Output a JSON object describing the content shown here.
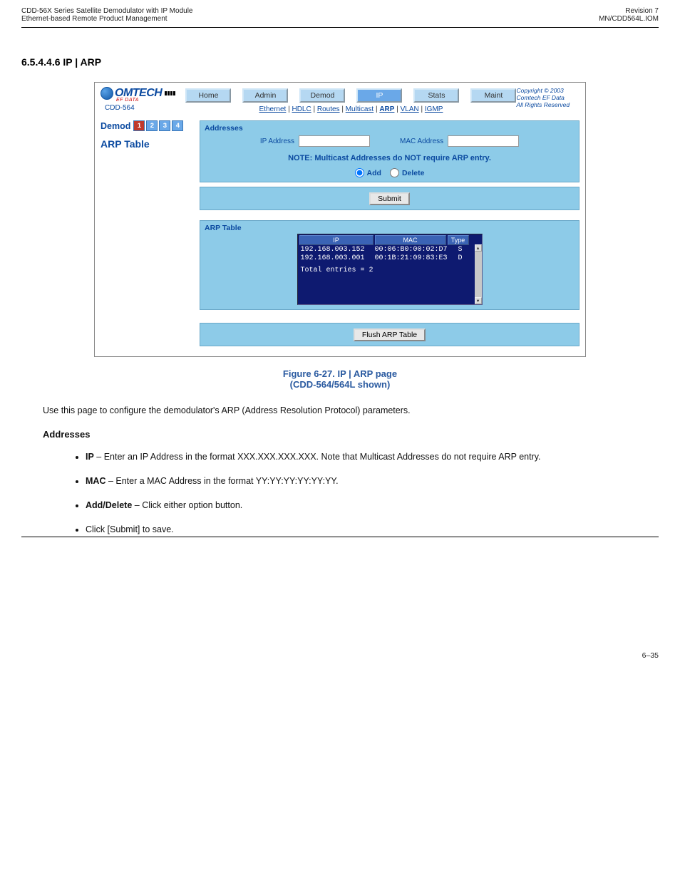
{
  "header": {
    "left_line1": "CDD-56X Series Satellite Demodulator with IP Module",
    "left_line2": "Ethernet-based Remote Product Management",
    "right_line1": "Revision 7",
    "right_line2": "MN/CDD564L.IOM"
  },
  "section_path": "6.5.4.4.6 IP | ARP",
  "app": {
    "device": "CDD-564",
    "main_tabs": [
      "Home",
      "Admin",
      "Demod",
      "IP",
      "Stats",
      "Maint"
    ],
    "active_tab": "IP",
    "sub_tabs": [
      "Ethernet",
      "HDLC",
      "Routes",
      "Multicast",
      "ARP",
      "VLAN",
      "IGMP"
    ],
    "active_sub": "ARP",
    "copyright": {
      "line1": "Copyright © 2003",
      "line2": "Comtech EF Data",
      "line3": "All Rights Reserved"
    },
    "demod": {
      "label": "Demod",
      "buttons": [
        "1",
        "2",
        "3",
        "4"
      ],
      "active_index": 0
    },
    "title": "ARP Table",
    "addresses": {
      "title": "Addresses",
      "ip_label": "IP Address",
      "ip_value": "",
      "mac_label": "MAC Address",
      "mac_value": "",
      "note": "NOTE: Multicast Addresses do NOT require ARP entry.",
      "radio_add": "Add",
      "radio_delete": "Delete",
      "radio_state": "Add"
    },
    "submit_label": "Submit",
    "arp_table": {
      "title": "ARP Table",
      "columns": [
        "IP",
        "MAC",
        "Type"
      ],
      "rows": [
        {
          "ip": "192.168.003.152",
          "mac": "00:06:B0:00:02:D7",
          "type": "S"
        },
        {
          "ip": "192.168.003.001",
          "mac": "00:1B:21:09:83:E3",
          "type": "D"
        }
      ],
      "footer": "Total entries = 2"
    },
    "flush_label": "Flush ARP Table"
  },
  "caption": {
    "fig": "Figure 6-27. IP | ARP page",
    "note": "(CDD-564/564L shown)"
  },
  "para": "Use this page to configure the demodulator's ARP (Address Resolution Protocol) parameters.",
  "addresses_heading": "Addresses",
  "bullets": [
    {
      "label": "IP",
      "text": " – Enter an IP Address in the format XXX.XXX.XXX.XXX. Note that Multicast Addresses do not require ARP entry."
    },
    {
      "label": "MAC",
      "text": " – Enter a MAC Address in the format YY:YY:YY:YY:YY:YY."
    },
    {
      "label": "Add/Delete",
      "text": " – Click either option button."
    },
    {
      "label": "",
      "text": "Click [Submit] to save."
    }
  ],
  "footer": {
    "page": "6–35"
  }
}
